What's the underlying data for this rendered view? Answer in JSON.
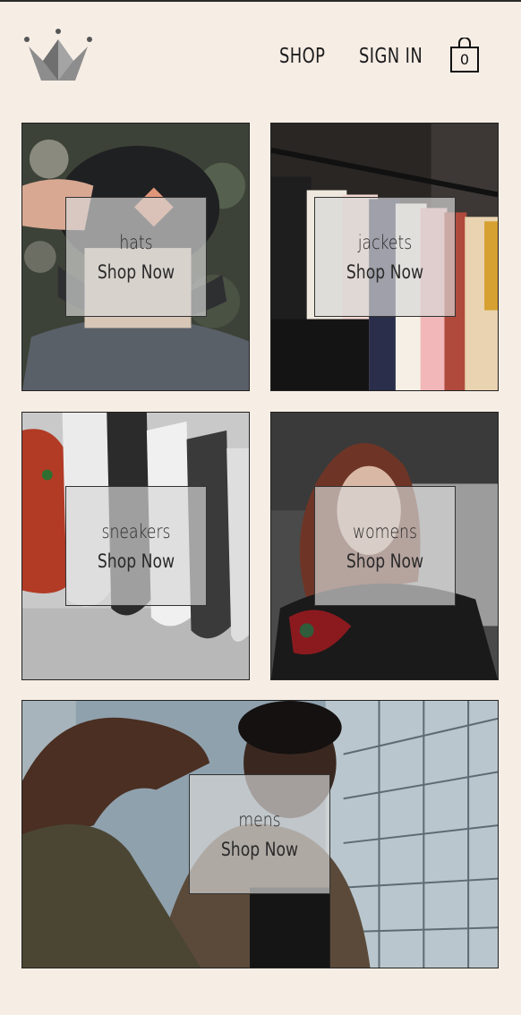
{
  "header": {
    "nav": [
      {
        "label": "SHOP"
      },
      {
        "label": "SIGN IN"
      }
    ],
    "cart_count": "0",
    "logo_icon": "crown-icon",
    "cart_icon": "shopping-bag-icon"
  },
  "categories": [
    {
      "title": "hats",
      "cta": "Shop Now"
    },
    {
      "title": "jackets",
      "cta": "Shop Now"
    },
    {
      "title": "sneakers",
      "cta": "Shop Now"
    },
    {
      "title": "womens",
      "cta": "Shop Now"
    },
    {
      "title": "mens",
      "cta": "Shop Now"
    }
  ],
  "colors": {
    "page_bg": "#f6ede5",
    "text": "#222222",
    "overlay": "rgba(215,215,215,0.68)"
  }
}
